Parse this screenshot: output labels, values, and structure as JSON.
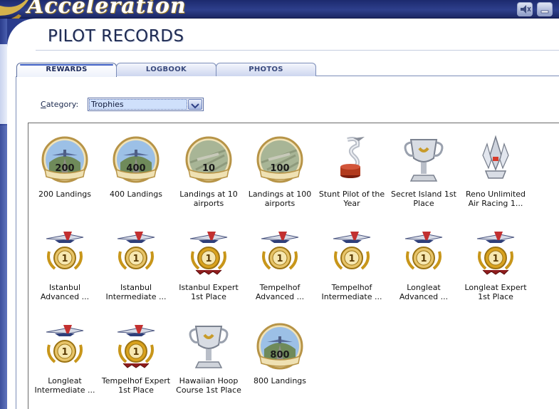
{
  "window": {
    "brand_title": "Acceleration",
    "sound_icon": "speaker-muted-icon",
    "minimize_icon": "minimize-icon"
  },
  "page": {
    "title": "PILOT RECORDS"
  },
  "tabs": [
    {
      "label": "REWARDS",
      "active": true
    },
    {
      "label": "LOGBOOK",
      "active": false
    },
    {
      "label": "PHOTOS",
      "active": false
    }
  ],
  "category": {
    "label_underlined": "C",
    "label_rest": "ategory:",
    "selected": "Trophies"
  },
  "trophies": [
    {
      "label": "200 Landings",
      "icon": "landing-badge-icon",
      "badge": "200"
    },
    {
      "label": "400 Landings",
      "icon": "landing-badge-icon",
      "badge": "400"
    },
    {
      "label": "Landings at 10 airports",
      "icon": "airport-badge-icon",
      "badge": "10"
    },
    {
      "label": "Landings at 100 airports",
      "icon": "airport-badge-icon",
      "badge": "100"
    },
    {
      "label": "Stunt Pilot of the Year",
      "icon": "stunt-trophy-icon",
      "badge": ""
    },
    {
      "label": "Secret Island 1st Place",
      "icon": "silver-cup-icon",
      "badge": ""
    },
    {
      "label": "Reno Unlimited Air Racing 1...",
      "icon": "reno-trophy-icon",
      "badge": ""
    },
    {
      "label": "Istanbul Advanced ...",
      "icon": "air-race-medal-icon",
      "badge": "1"
    },
    {
      "label": "Istanbul Intermediate ...",
      "icon": "air-race-medal-icon",
      "badge": "1"
    },
    {
      "label": "Istanbul Expert 1st Place",
      "icon": "air-race-expert-medal-icon",
      "badge": "1"
    },
    {
      "label": "Tempelhof Advanced ...",
      "icon": "air-race-medal-icon",
      "badge": "1"
    },
    {
      "label": "Tempelhof Intermediate ...",
      "icon": "air-race-medal-icon",
      "badge": "1"
    },
    {
      "label": "Longleat Advanced ...",
      "icon": "air-race-medal-icon",
      "badge": "1"
    },
    {
      "label": "Longleat Expert 1st Place",
      "icon": "air-race-expert-medal-icon",
      "badge": "1"
    },
    {
      "label": "Longleat Intermediate ...",
      "icon": "air-race-medal-icon",
      "badge": "1"
    },
    {
      "label": "Tempelhof Expert 1st Place",
      "icon": "air-race-expert-medal-icon",
      "badge": "1"
    },
    {
      "label": "Hawaiian Hoop Course 1st Place",
      "icon": "silver-cup-icon",
      "badge": ""
    },
    {
      "label": "800 Landings",
      "icon": "landing-badge-icon",
      "badge": "800"
    }
  ],
  "colors": {
    "banner": "#2e3f8c",
    "brand_gold": "#c8a13a",
    "tab_active_accent": "#3a5cc2",
    "selection_fill": "#cfe0fb"
  }
}
